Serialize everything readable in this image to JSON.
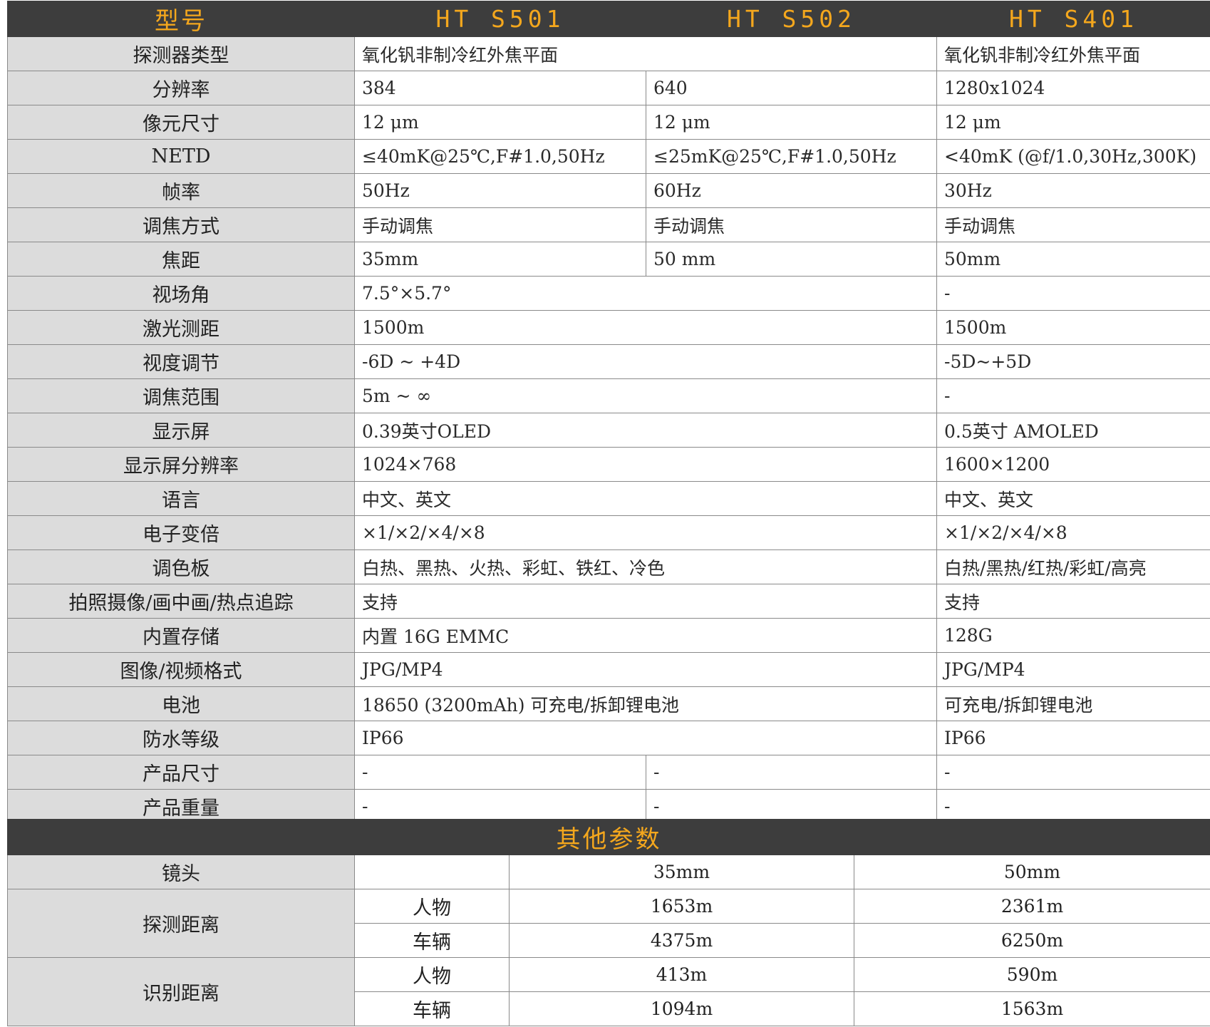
{
  "header": {
    "model_label": "型号",
    "models": [
      "HT S501",
      "HT S502",
      "HT S401"
    ]
  },
  "specs": [
    {
      "label": "探测器类型",
      "merged": "氧化钒非制冷红外焦平面",
      "s401": "氧化钒非制冷红外焦平面"
    },
    {
      "label": "分辨率",
      "s501": "384",
      "s502": "640",
      "s401": "1280x1024"
    },
    {
      "label": "像元尺寸",
      "s501": "12 μm",
      "s502": "12 μm",
      "s401": "12 μm"
    },
    {
      "label": "NETD",
      "s501": "≤40mK@25℃,F#1.0,50Hz",
      "s502": "≤25mK@25℃,F#1.0,50Hz",
      "s401": "<40mK (@f/1.0,30Hz,300K)"
    },
    {
      "label": "帧率",
      "s501": "50Hz",
      "s502": "60Hz",
      "s401": "30Hz"
    },
    {
      "label": "调焦方式",
      "s501": "手动调焦",
      "s502": "手动调焦",
      "s401": "手动调焦"
    },
    {
      "label": "焦距",
      "s501": "35mm",
      "s502": "50 mm",
      "s401": "50mm"
    },
    {
      "label": "视场角",
      "merged": "7.5°×5.7°",
      "s401": "-"
    },
    {
      "label": "激光测距",
      "merged": "1500m",
      "s401": "1500m"
    },
    {
      "label": "视度调节",
      "merged": "-6D ~ +4D",
      "s401": "-5D~+5D"
    },
    {
      "label": "调焦范围",
      "merged": "5m ~ ∞",
      "s401": "-"
    },
    {
      "label": "显示屏",
      "merged": "0.39英寸OLED",
      "s401": "0.5英寸 AMOLED"
    },
    {
      "label": "显示屏分辨率",
      "merged": "1024×768",
      "s401": "1600×1200"
    },
    {
      "label": "语言",
      "merged": "中文、英文",
      "s401": "中文、英文"
    },
    {
      "label": "电子变倍",
      "merged": "×1/×2/×4/×8",
      "s401": "×1/×2/×4/×8"
    },
    {
      "label": "调色板",
      "merged": "白热、黑热、火热、彩虹、铁红、冷色",
      "s401": "白热/黑热/红热/彩虹/高亮"
    },
    {
      "label": "拍照摄像/画中画/热点追踪",
      "merged": "支持",
      "s401": "支持"
    },
    {
      "label": "内置存储",
      "merged": "内置 16G EMMC",
      "s401": "128G"
    },
    {
      "label": "图像/视频格式",
      "merged": "JPG/MP4",
      "s401": "JPG/MP4"
    },
    {
      "label": "电池",
      "merged": "18650 (3200mAh) 可充电/拆卸锂电池",
      "s401": "可充电/拆卸锂电池"
    },
    {
      "label": "防水等级",
      "merged": "IP66",
      "s401": "IP66"
    },
    {
      "label": "产品尺寸",
      "s501": "-",
      "s502": "-",
      "s401": "-"
    },
    {
      "label": "产品重量",
      "s501": "-",
      "s502": "-",
      "s401": "-"
    }
  ],
  "other": {
    "title": "其他参数",
    "lens_label": "镜头",
    "lens": [
      "35mm",
      "50mm"
    ],
    "detect_label": "探测距离",
    "recog_label": "识别距离",
    "person": "人物",
    "vehicle": "车辆",
    "detect_person": [
      "1653m",
      "2361m"
    ],
    "detect_vehicle": [
      "4375m",
      "6250m"
    ],
    "recog_person": [
      "413m",
      "590m"
    ],
    "recog_vehicle": [
      "1094m",
      "1563m"
    ]
  }
}
